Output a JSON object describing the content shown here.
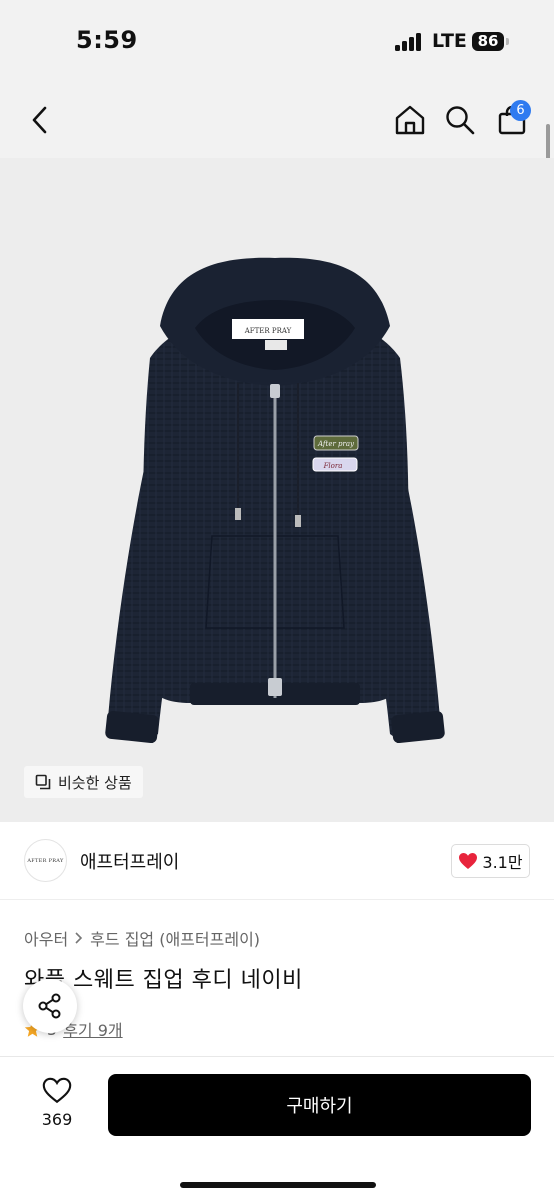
{
  "status_bar": {
    "time": "5:59",
    "network": "LTE",
    "battery": "86"
  },
  "nav": {
    "cart_count": "6",
    "icons": [
      "back-arrow-icon",
      "home-icon",
      "search-icon",
      "shopping-bag-icon"
    ]
  },
  "product_image": {
    "alt": "navy waffle knit zip-up hoodie",
    "hood_tag": "AFTER PRAY",
    "patch_1": "After pray",
    "patch_2": "Flora",
    "colors": {
      "hoodie": "#1d2535",
      "background": "#ededed"
    }
  },
  "similar_button": {
    "label": "비슷한 상품"
  },
  "brand": {
    "logo_text": "AFTER PRAY",
    "name": "애프터프레이",
    "likes": "3.1만"
  },
  "breadcrumb": {
    "category": "아우터",
    "subcategory": "후드 집업 (애프터프레이)"
  },
  "product": {
    "title": "와플 스웨트 집업 후디 네이비",
    "rating": "5",
    "reviews": "후기 9개"
  },
  "bottom_bar": {
    "wish_count": "369",
    "buy_label": "구매하기"
  },
  "colors": {
    "accent": "#2f7bf0",
    "like": "#e8243c",
    "star": "#f5a623",
    "buy_button": "#000000"
  }
}
